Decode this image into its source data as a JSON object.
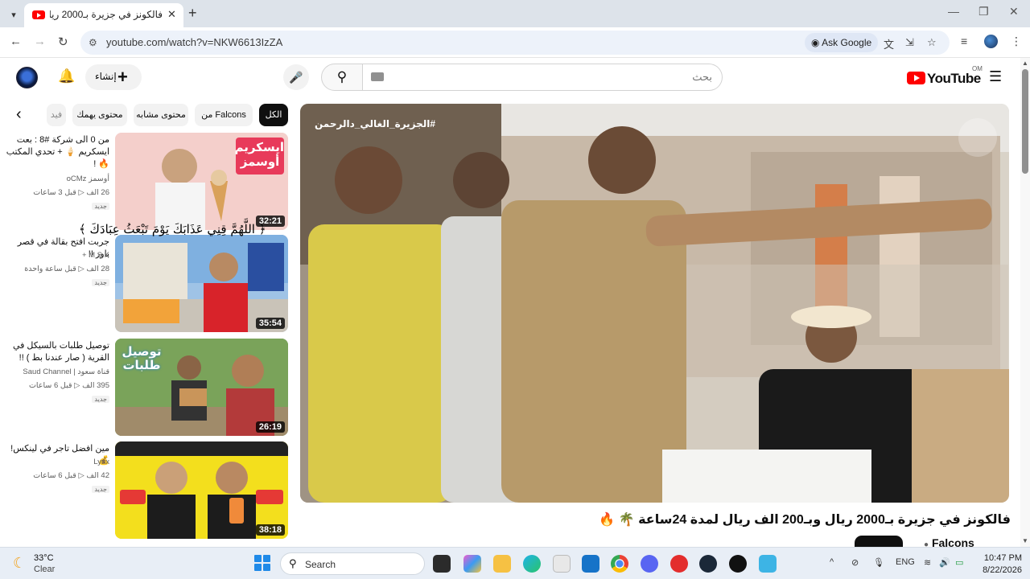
{
  "browser": {
    "tab_title": "فالكونز في جزيرة بـ2000 ريال وبـ",
    "url": "youtube.com/watch?v=NKW6613IzZA",
    "ask_google": "Ask Google"
  },
  "header": {
    "create_label": "إنشاء",
    "search_placeholder": "بحث",
    "logo_text": "YouTube",
    "country_code": "OM"
  },
  "chips": [
    "الكل",
    "من Falcons",
    "محتوى مشابه",
    "محتوى يهمك",
    "فيد"
  ],
  "related": [
    {
      "title": "من 0 الى شركة #8 : بعت ايسكريم 🍦 + تحدي المكتب 🔥 !",
      "channel": "أوسمز oCMz",
      "views": "26 الف",
      "age": "قبل 3 ساعات",
      "badge": "جديد",
      "duration": "32:21",
      "thumb_text": "ايسكريم أوسمز"
    },
    {
      "title": "جربت افتح بقالة في قصر باور !!",
      "channel": "M S K +",
      "views": "28 الف",
      "age": "قبل ساعة واحدة",
      "badge": "جديد",
      "duration": "35:54",
      "thumb_text": ""
    },
    {
      "title": "توصيل طلبات بالسيكل في القرية ( صار عندنا بط ) !!",
      "channel": "قناة سعود | Saud Channel",
      "views": "395 الف",
      "age": "قبل 6 ساعات",
      "badge": "جديد",
      "duration": "26:19",
      "thumb_text": "توصيل طلبات"
    },
    {
      "title": "مين افضل تاجر في لينكس! 💰",
      "channel": "Lynx",
      "views": "42 الف",
      "age": "قبل 6 ساعات",
      "badge": "جديد",
      "duration": "38:18",
      "thumb_text": ""
    }
  ],
  "overlay_text": "﴿ اللَّهُمَّ قِنِي عَذَابَكَ يَوْمَ تَبْعَثُ عِبَادَكَ ﴾",
  "player": {
    "hashtag": "#الجزيرة_الغالي_دالرحمن"
  },
  "video": {
    "title": "فالكونز في جزيرة بـ2000 ريال وبـ200 الف ريال لمدة 24ساعة 🌴 🔥",
    "channel": "Falcons"
  },
  "taskbar": {
    "temp": "33°C",
    "condition": "Clear",
    "search_label": "Search",
    "lang": "ENG",
    "time": "10:47 PM",
    "date": "8/22/2026"
  },
  "colors": {
    "yt_red": "#ff0000",
    "chip_active": "#0f0f0f"
  }
}
